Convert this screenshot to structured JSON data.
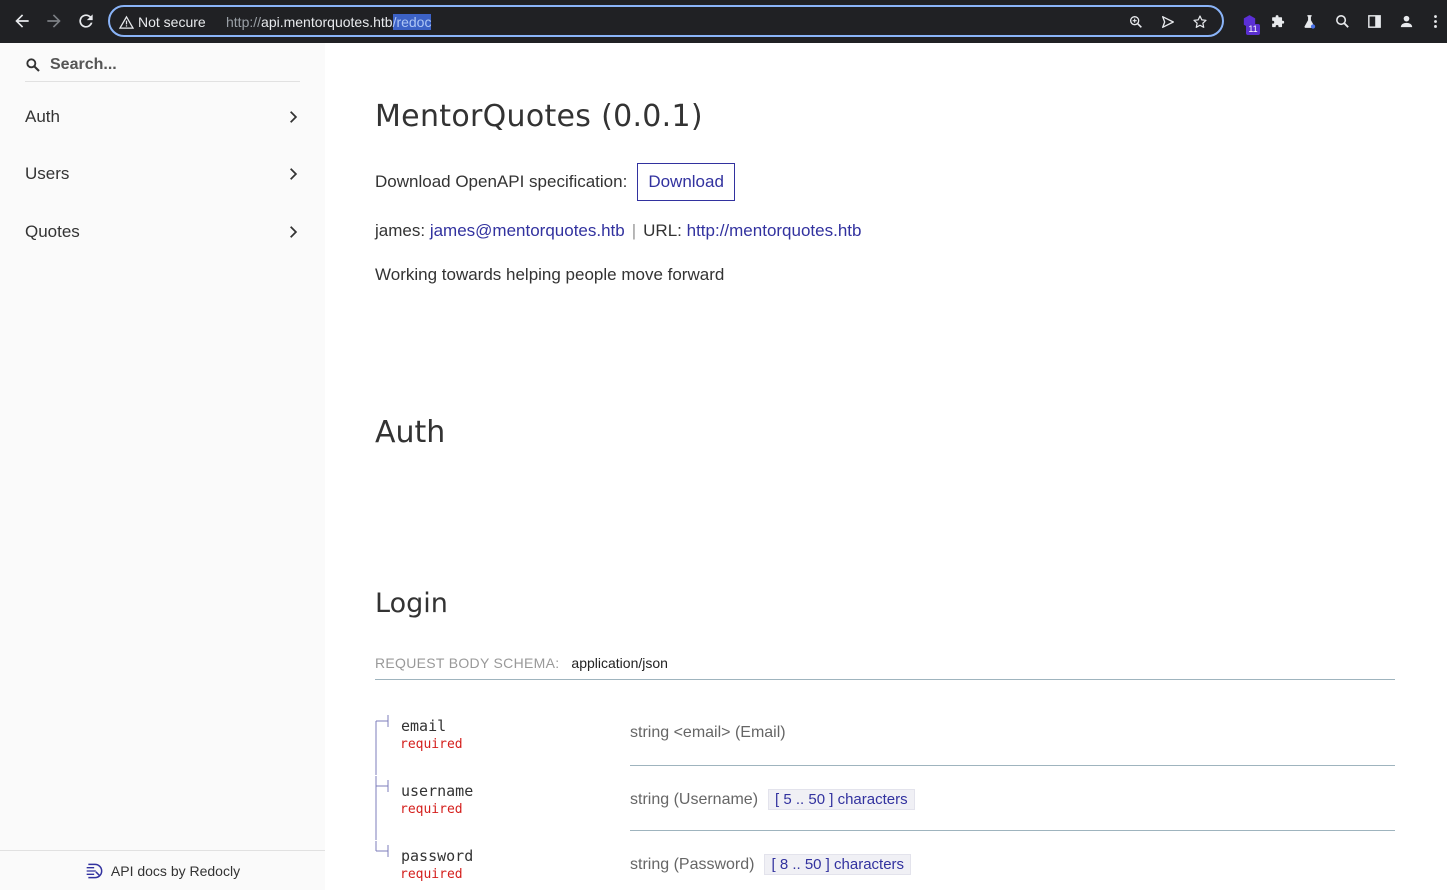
{
  "browser": {
    "security_label": "Not secure",
    "url_scheme": "http://",
    "url_host": "api.mentorquotes.htb",
    "url_path_selected": "/redoc",
    "extension_badge": "11"
  },
  "sidebar": {
    "search_placeholder": "Search...",
    "items": [
      {
        "label": "Auth"
      },
      {
        "label": "Users"
      },
      {
        "label": "Quotes"
      }
    ],
    "footer_label": "API docs by Redocly"
  },
  "main": {
    "title": "MentorQuotes (0.0.1)",
    "download_prefix": "Download OpenAPI specification:",
    "download_label": "Download",
    "contact_name": "james:",
    "contact_email": "james@mentorquotes.htb",
    "url_label": "URL:",
    "url_value": "http://mentorquotes.htb",
    "description": "Working towards helping people move forward",
    "section_title": "Auth",
    "operation_title": "Login",
    "request_body_label": "REQUEST BODY SCHEMA:",
    "request_body_content_type": "application/json",
    "properties": [
      {
        "name": "email",
        "required": "required",
        "type": "string <email> (Email)",
        "range": ""
      },
      {
        "name": "username",
        "required": "required",
        "type": "string (Username)",
        "range": "[ 5 .. 50 ] characters"
      },
      {
        "name": "password",
        "required": "required",
        "type": "string (Password)",
        "range": "[ 8 .. 50 ] characters"
      }
    ]
  },
  "colors": {
    "accent": "#32329f",
    "required": "#d41f1c",
    "omnibox_border": "#8ab4f8",
    "chrome_bg": "#202124"
  }
}
